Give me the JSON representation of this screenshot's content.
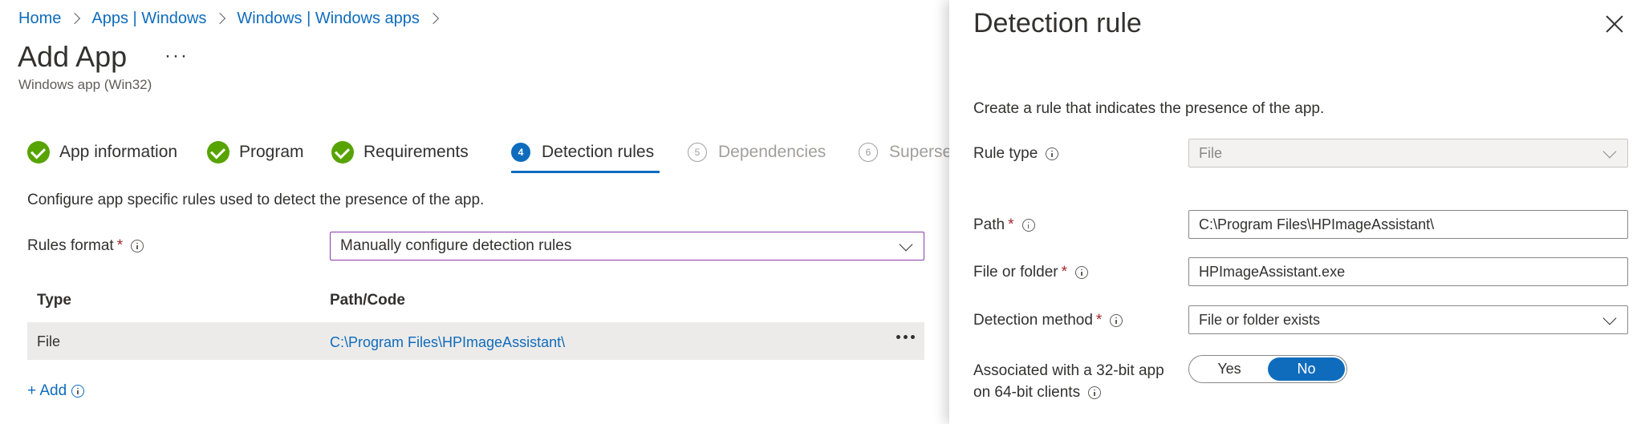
{
  "breadcrumb": [
    {
      "label": "Home"
    },
    {
      "label": "Apps | Windows"
    },
    {
      "label": "Windows | Windows apps"
    }
  ],
  "page": {
    "title": "Add App",
    "more": "···",
    "subtitle": "Windows app (Win32)"
  },
  "tabs": [
    {
      "label": "App information",
      "state": "complete"
    },
    {
      "label": "Program",
      "state": "complete"
    },
    {
      "label": "Requirements",
      "state": "complete"
    },
    {
      "label": "Detection rules",
      "number": "4",
      "state": "active"
    },
    {
      "label": "Dependencies",
      "number": "5",
      "state": "disabled"
    },
    {
      "label": "Superse",
      "number": "6",
      "state": "disabled"
    }
  ],
  "main": {
    "description": "Configure app specific rules used to detect the presence of the app.",
    "rules_format": {
      "label": "Rules format",
      "required": "*",
      "value": "Manually configure detection rules"
    },
    "table": {
      "columns": [
        "Type",
        "Path/Code"
      ],
      "rows": [
        {
          "type": "File",
          "path": "C:\\Program Files\\HPImageAssistant\\"
        }
      ]
    },
    "add_label": "+ Add"
  },
  "panel": {
    "title": "Detection rule",
    "description": "Create a rule that indicates the presence of the app.",
    "rule_type": {
      "label": "Rule type",
      "value": "File"
    },
    "path": {
      "label": "Path",
      "required": "*",
      "value": "C:\\Program Files\\HPImageAssistant\\"
    },
    "file_or_folder": {
      "label": "File or folder",
      "required": "*",
      "value": "HPImageAssistant.exe"
    },
    "detection_method": {
      "label": "Detection method",
      "required": "*",
      "value": "File or folder exists"
    },
    "associated": {
      "label_line1": "Associated with a 32-bit app",
      "label_line2": "on 64-bit clients",
      "yes": "Yes",
      "no": "No",
      "selected": "No"
    }
  },
  "colors": {
    "accent": "#0f6cbd",
    "success": "#57a300",
    "required": "#a4262c",
    "focus_border": "#8a3ba8"
  }
}
